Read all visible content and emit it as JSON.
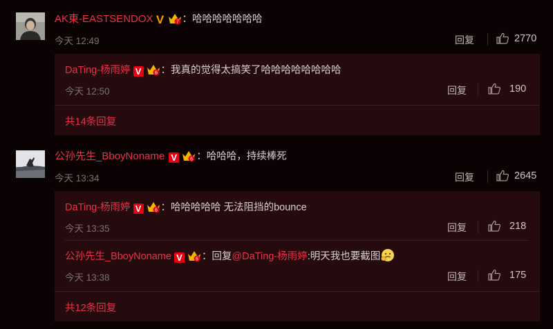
{
  "comments": [
    {
      "nick": "AK東-EASTSENDOX",
      "text": "哈哈哈哈哈哈哈",
      "time": "今天 12:49",
      "reply_label": "回复",
      "likes": "2770",
      "replies": [
        {
          "nick": "DaTing-杨雨婷",
          "text": "我真的觉得太搞笑了哈哈哈哈哈哈哈哈",
          "time": "今天 12:50",
          "reply_label": "回复",
          "likes": "190"
        }
      ],
      "more": "共14条回复"
    },
    {
      "nick": "公孙先生_BboyNoname",
      "text": "哈哈哈，持续棒死",
      "time": "今天 13:34",
      "reply_label": "回复",
      "likes": "2645",
      "replies": [
        {
          "nick": "DaTing-杨雨婷",
          "text": "哈哈哈哈哈 无法阻挡的bounce",
          "time": "今天 13:35",
          "reply_label": "回复",
          "likes": "218"
        },
        {
          "nick": "公孙先生_BboyNoname",
          "prefix": "回复",
          "mention": "@DaTing-杨雨婷",
          "text": ":明天我也要截图",
          "time": "今天 13:38",
          "reply_label": "回复",
          "likes": "175"
        }
      ],
      "more": "共12条回复"
    }
  ],
  "badges": {
    "verified": "V",
    "separator": "："
  },
  "colors": {
    "accent": "#e8324a",
    "background": "#0b0303",
    "panel": "#250b0d"
  }
}
